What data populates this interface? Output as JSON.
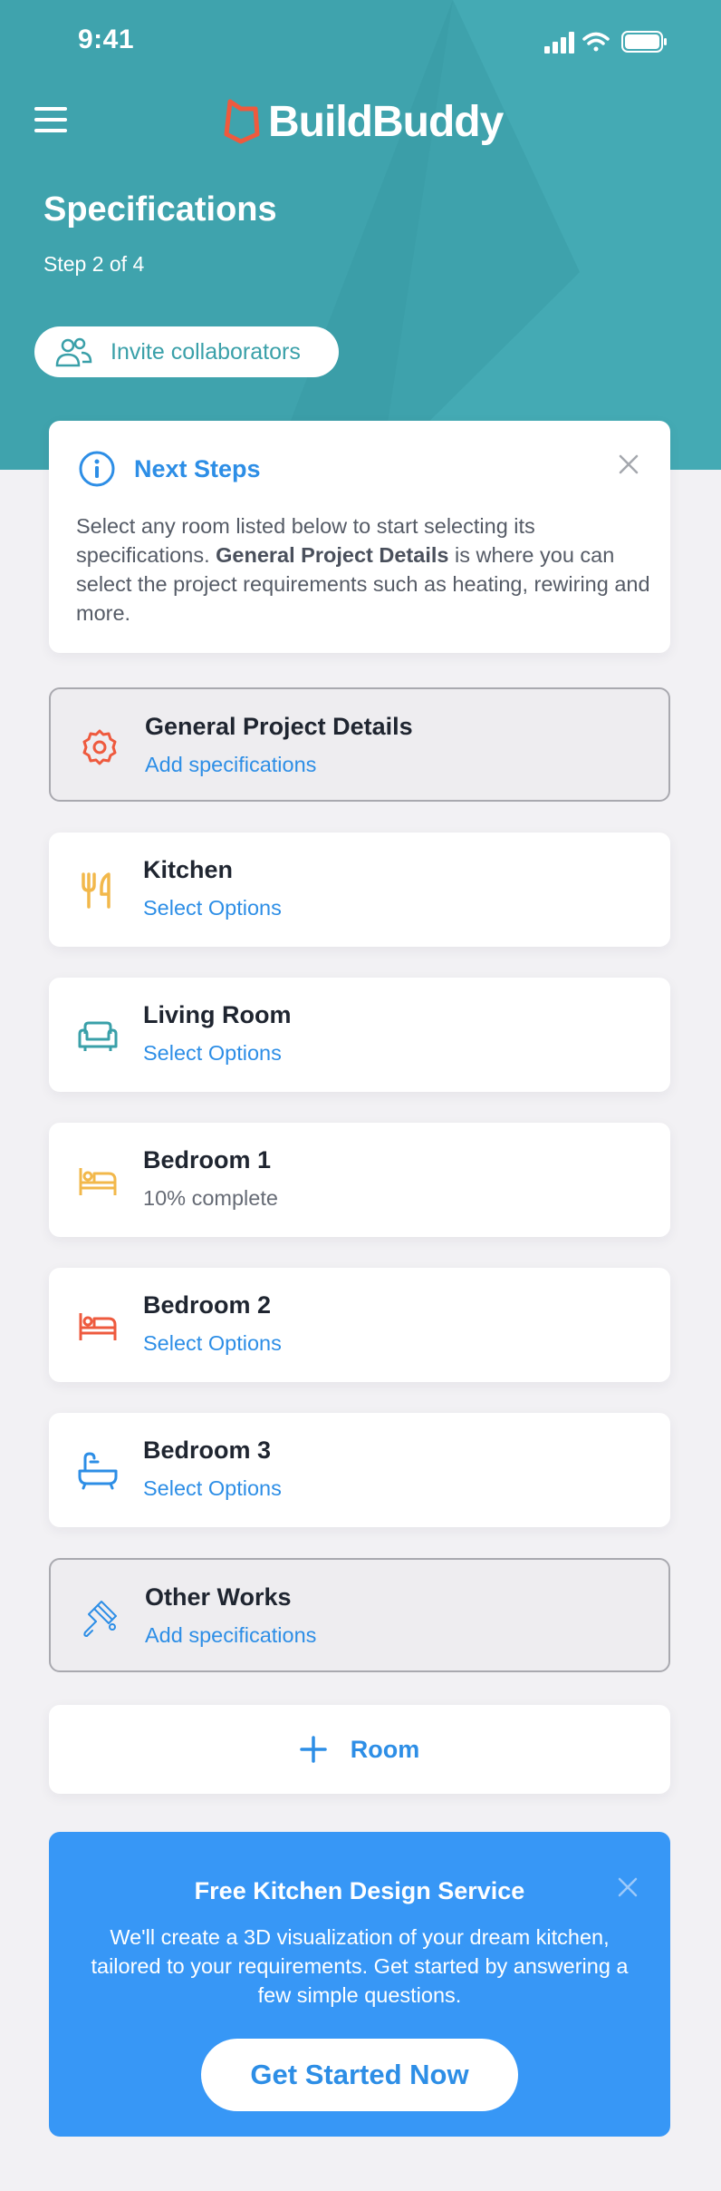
{
  "status_bar": {
    "time": "9:41"
  },
  "brand": {
    "name": "BuildBuddy",
    "accent": "#EE5A3E"
  },
  "header": {
    "title": "Specifications",
    "step": "Step 2 of 4",
    "invite_label": "Invite collaborators",
    "background": "#3FA3AD"
  },
  "info_card": {
    "title": "Next Steps",
    "body_before": "Select any room listed below to start selecting its specifications. ",
    "body_bold": "General Project Details",
    "body_after": " is where you can select the project requirements such as heating, rewiring and more."
  },
  "rooms": [
    {
      "name": "General Project Details",
      "status": "Add specifications",
      "icon": "gear-icon",
      "icon_color": "#EE5A3E"
    },
    {
      "name": "Kitchen",
      "status": "Select Options",
      "icon": "fork-knife-icon",
      "icon_color": "#F2B84B"
    },
    {
      "name": "Living Room",
      "status": "Select Options",
      "icon": "sofa-icon",
      "icon_color": "#3AA0A9"
    },
    {
      "name": "Bedroom 1",
      "status": "10% complete",
      "icon": "bed-icon",
      "icon_color": "#F2B84B",
      "progress": 0.1
    },
    {
      "name": "Bedroom 2",
      "status": "Select Options",
      "icon": "bed-icon",
      "icon_color": "#EE5A3E"
    },
    {
      "name": "Bedroom 3",
      "status": "Select Options",
      "icon": "bathtub-icon",
      "icon_color": "#2D8EE6"
    },
    {
      "name": "Other Works",
      "status": "Add specifications",
      "icon": "paint-roller-icon",
      "icon_color": "#2D8EE6"
    }
  ],
  "add_room": {
    "label": "Room"
  },
  "promo": {
    "title": "Free Kitchen Design Service",
    "body": "We'll create a 3D visualization of your dream kitchen, tailored to your requirements. Get started by answering a few simple questions.",
    "cta": "Get Started Now",
    "background": "#3797F6"
  }
}
